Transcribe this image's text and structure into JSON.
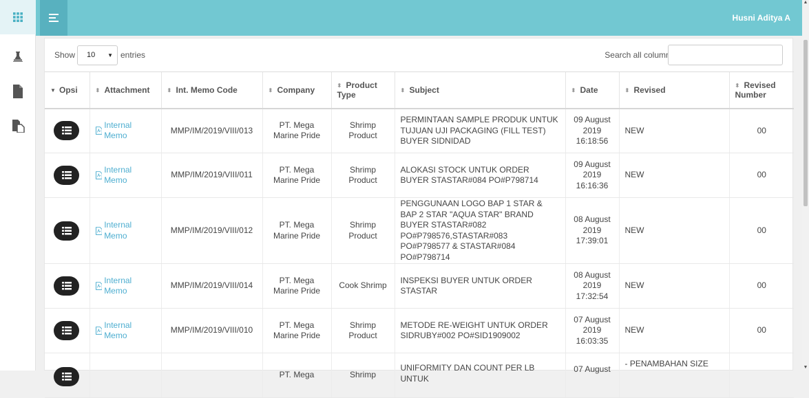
{
  "user": {
    "name": "Husni Aditya A"
  },
  "sidebar": [
    "grid-icon",
    "flask-icon",
    "document-icon",
    "copy-documents-icon"
  ],
  "table_controls": {
    "show_label": "Show",
    "page_size": "10",
    "entries_label": "entries",
    "search_label": "Search all columns:",
    "search_value": ""
  },
  "columns": {
    "opsi": "Opsi",
    "attachment": "Attachment",
    "memo_code": "Int. Memo Code",
    "company": "Company",
    "product_type": "Product Type",
    "subject": "Subject",
    "date": "Date",
    "revised": "Revised",
    "revised_number": "Revised Number"
  },
  "rows": [
    {
      "attachment": "Internal Memo",
      "code": "MMP/IM/2019/VIII/013",
      "company": "PT. Mega Marine Pride",
      "product_type": "Shrimp Product",
      "subject": "PERMINTAAN SAMPLE PRODUK UNTUK TUJUAN UJI PACKAGING (FILL TEST) BUYER SIDNIDAD",
      "date": "09 August 2019 16:18:56",
      "revised": "NEW",
      "revised_number": "00"
    },
    {
      "attachment": "Internal Memo",
      "code": "MMP/IM/2019/VIII/011",
      "company": "PT. Mega Marine Pride",
      "product_type": "Shrimp Product",
      "subject": "ALOKASI STOCK UNTUK ORDER BUYER STASTAR#084 PO#P798714",
      "date": "09 August 2019 16:16:36",
      "revised": "NEW",
      "revised_number": "00"
    },
    {
      "attachment": "Internal Memo",
      "code": "MMP/IM/2019/VIII/012",
      "company": "PT. Mega Marine Pride",
      "product_type": "Shrimp Product",
      "subject": "PENGGUNAAN LOGO BAP 1 STAR & BAP 2 STAR \"AQUA STAR\" BRAND BUYER STASTAR#082 PO#P798576,STASTAR#083 PO#P798577 & STASTAR#084 PO#P798714",
      "date": "08 August 2019 17:39:01",
      "revised": "NEW",
      "revised_number": "00"
    },
    {
      "attachment": "Internal Memo",
      "code": "MMP/IM/2019/VIII/014",
      "company": "PT. Mega Marine Pride",
      "product_type": "Cook Shrimp",
      "subject": "INSPEKSI BUYER UNTUK ORDER STASTAR",
      "date": "08 August 2019 17:32:54",
      "revised": "NEW",
      "revised_number": "00"
    },
    {
      "attachment": "Internal Memo",
      "code": "MMP/IM/2019/VIII/010",
      "company": "PT. Mega Marine Pride",
      "product_type": "Shrimp Product",
      "subject": "METODE RE-WEIGHT UNTUK ORDER SIDRUBY#002 PO#SID1909002",
      "date": "07 August 2019 16:03:35",
      "revised": "NEW",
      "revised_number": "00"
    },
    {
      "attachment": "",
      "code": "",
      "company": "PT. Mega",
      "product_type": "Shrimp",
      "subject": "UNIFORMITY DAN COUNT PER LB UNTUK",
      "date": "07 August",
      "revised": "- PENAMBAHAN SIZE",
      "revised_number": ""
    }
  ]
}
